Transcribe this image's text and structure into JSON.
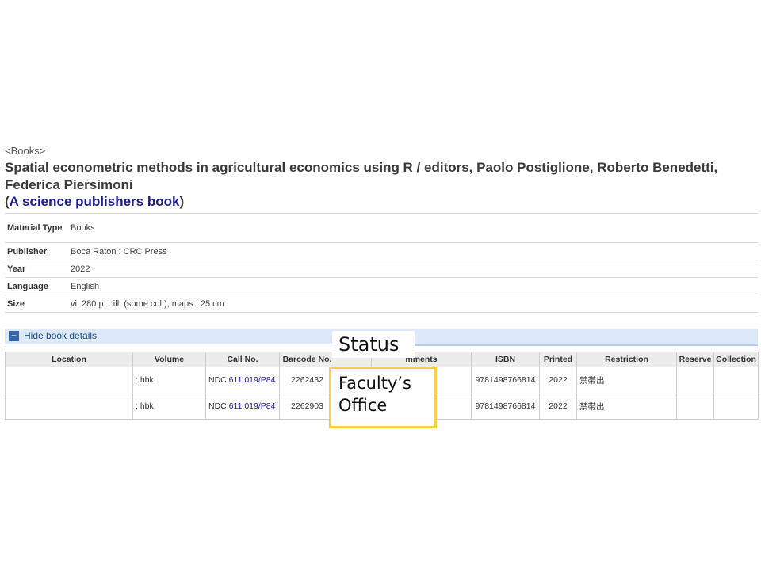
{
  "record": {
    "material_label": "<Books>",
    "title": "Spatial econometric methods in agricultural economics using R / editors, Paolo Postiglione, Roberto Benedetti, Federica Piersimoni",
    "series_open": "(",
    "series": "A science publishers book",
    "series_close": ")"
  },
  "details": [
    {
      "label": "Material Type",
      "value": "Books"
    },
    {
      "label": "Publisher",
      "value": "Boca Raton : CRC Press"
    },
    {
      "label": "Year",
      "value": "2022"
    },
    {
      "label": "Language",
      "value": "English"
    },
    {
      "label": "Size",
      "value": "vi, 280 p. : ill. (some col.), maps ; 25 cm"
    }
  ],
  "hide_details": {
    "icon": "minus-icon",
    "label": "Hide book details."
  },
  "holdings": {
    "headers": [
      "Location",
      "Volume",
      "Call No.",
      "Barcode No.",
      "",
      "mments",
      "ISBN",
      "Printed",
      "Restriction",
      "Reserve",
      "Collection"
    ],
    "rows": [
      {
        "location": "",
        "volume": ": hbk",
        "call_prefix": "NDC:",
        "call_no": "611.019/P84",
        "barcode": "2262432",
        "status": "",
        "comments": "",
        "isbn": "9781498766814",
        "printed": "2022",
        "restriction": "禁帯出",
        "reserve": "",
        "collection": ""
      },
      {
        "location": "",
        "volume": ": hbk",
        "call_prefix": "NDC:",
        "call_no": "611.019/P84",
        "barcode": "2262903",
        "status": "",
        "comments": "",
        "isbn": "9781498766814",
        "printed": "2022",
        "restriction": "禁帯出",
        "reserve": "",
        "collection": ""
      }
    ]
  },
  "annotations": {
    "status_label": "Status",
    "box_line1": "Faculty’s",
    "box_line2": "Office",
    "box_color": "#f5cf45"
  }
}
